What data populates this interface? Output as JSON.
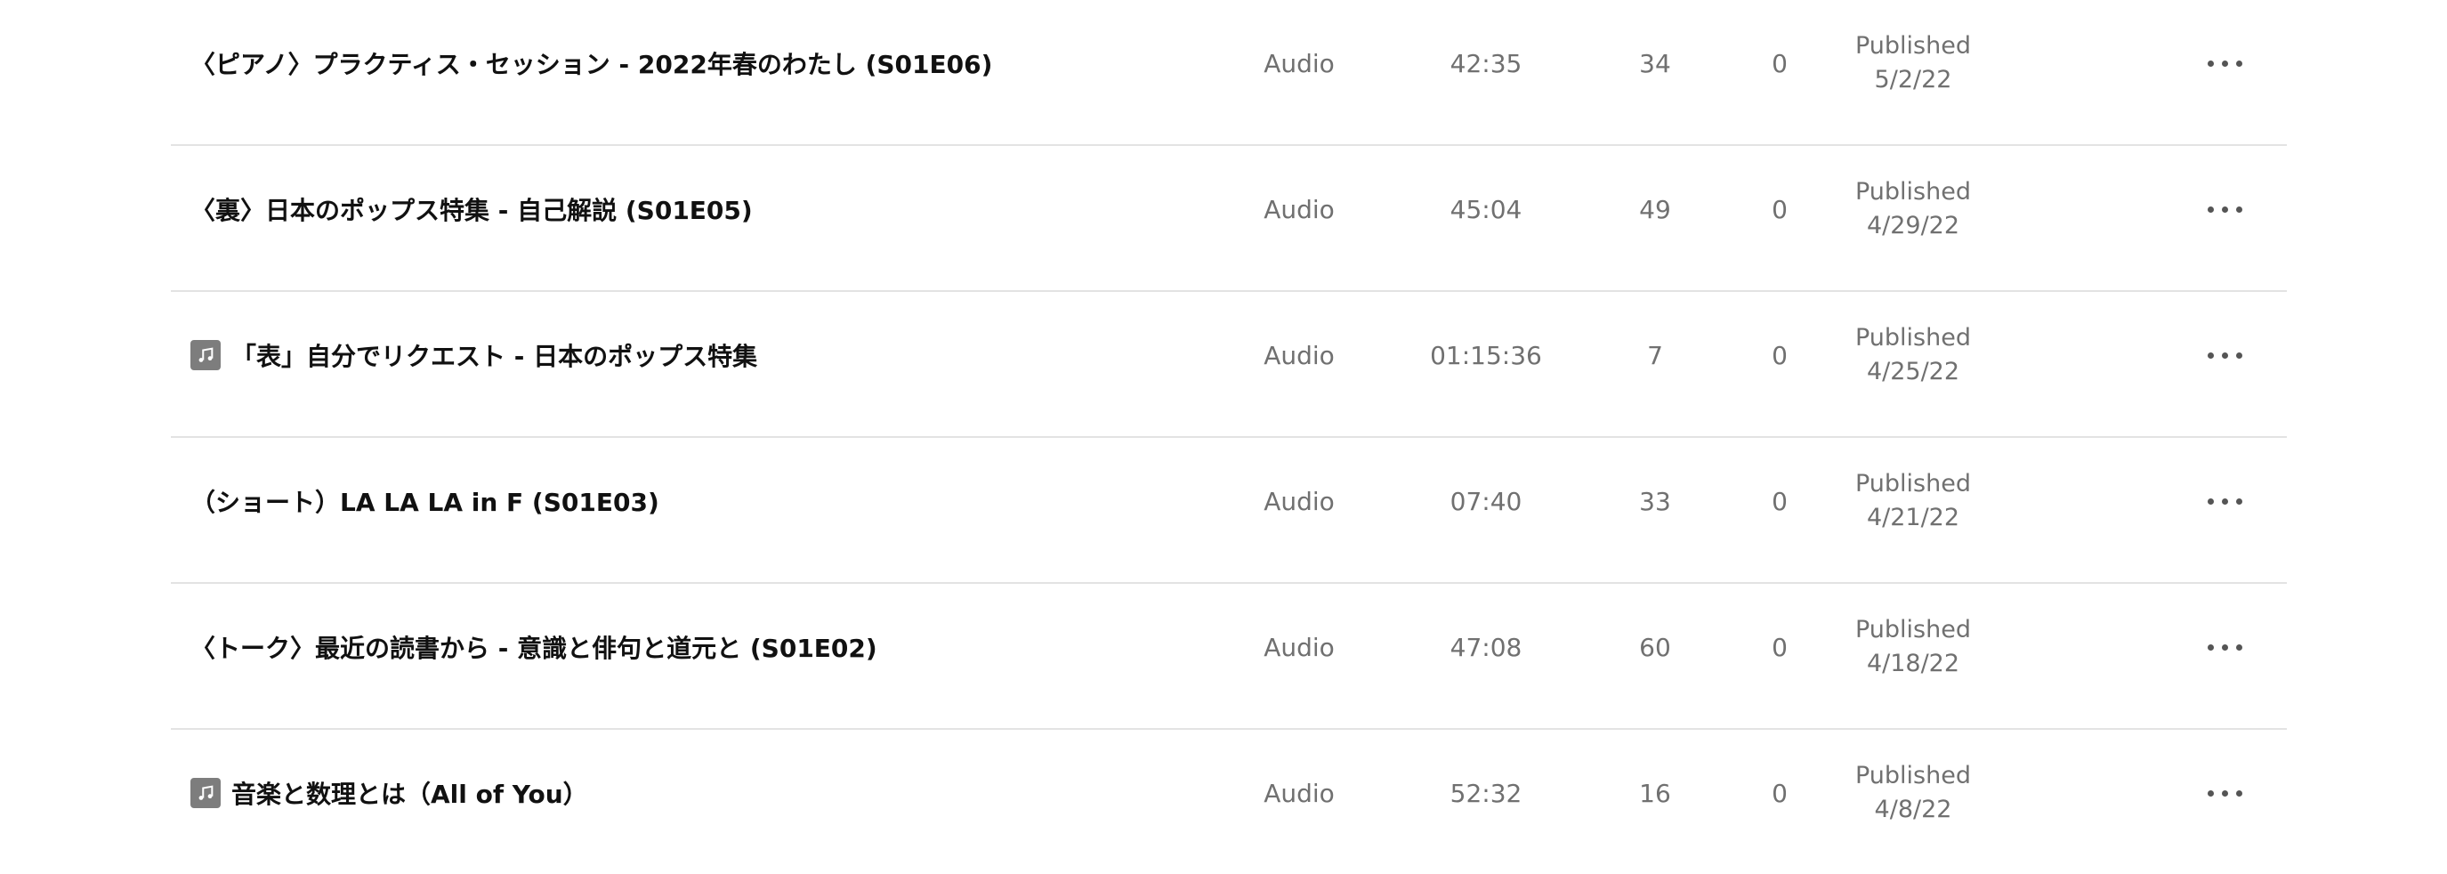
{
  "episodes": [
    {
      "title": "〈ピアノ〉プラクティス・セッション - 2022年春のわたし (S01E06)",
      "has_icon": false,
      "type": "Audio",
      "duration": "42:35",
      "plays": "34",
      "count2": "0",
      "status": "Published",
      "date": "5/2/22"
    },
    {
      "title": "〈裏〉日本のポップス特集 - 自己解説 (S01E05)",
      "has_icon": false,
      "type": "Audio",
      "duration": "45:04",
      "plays": "49",
      "count2": "0",
      "status": "Published",
      "date": "4/29/22"
    },
    {
      "title": "「表」自分でリクエスト - 日本のポップス特集",
      "has_icon": true,
      "icon": "music-note-icon",
      "type": "Audio",
      "duration": "01:15:36",
      "plays": "7",
      "count2": "0",
      "status": "Published",
      "date": "4/25/22"
    },
    {
      "title": "（ショート）LA LA LA in F (S01E03)",
      "has_icon": false,
      "type": "Audio",
      "duration": "07:40",
      "plays": "33",
      "count2": "0",
      "status": "Published",
      "date": "4/21/22"
    },
    {
      "title": "〈トーク〉最近の読書から - 意識と俳句と道元と (S01E02)",
      "has_icon": false,
      "type": "Audio",
      "duration": "47:08",
      "plays": "60",
      "count2": "0",
      "status": "Published",
      "date": "4/18/22"
    },
    {
      "title": "音楽と数理とは（All of You）",
      "has_icon": true,
      "icon": "music-note-icon",
      "type": "Audio",
      "duration": "52:32",
      "plays": "16",
      "count2": "0",
      "status": "Published",
      "date": "4/8/22"
    }
  ]
}
